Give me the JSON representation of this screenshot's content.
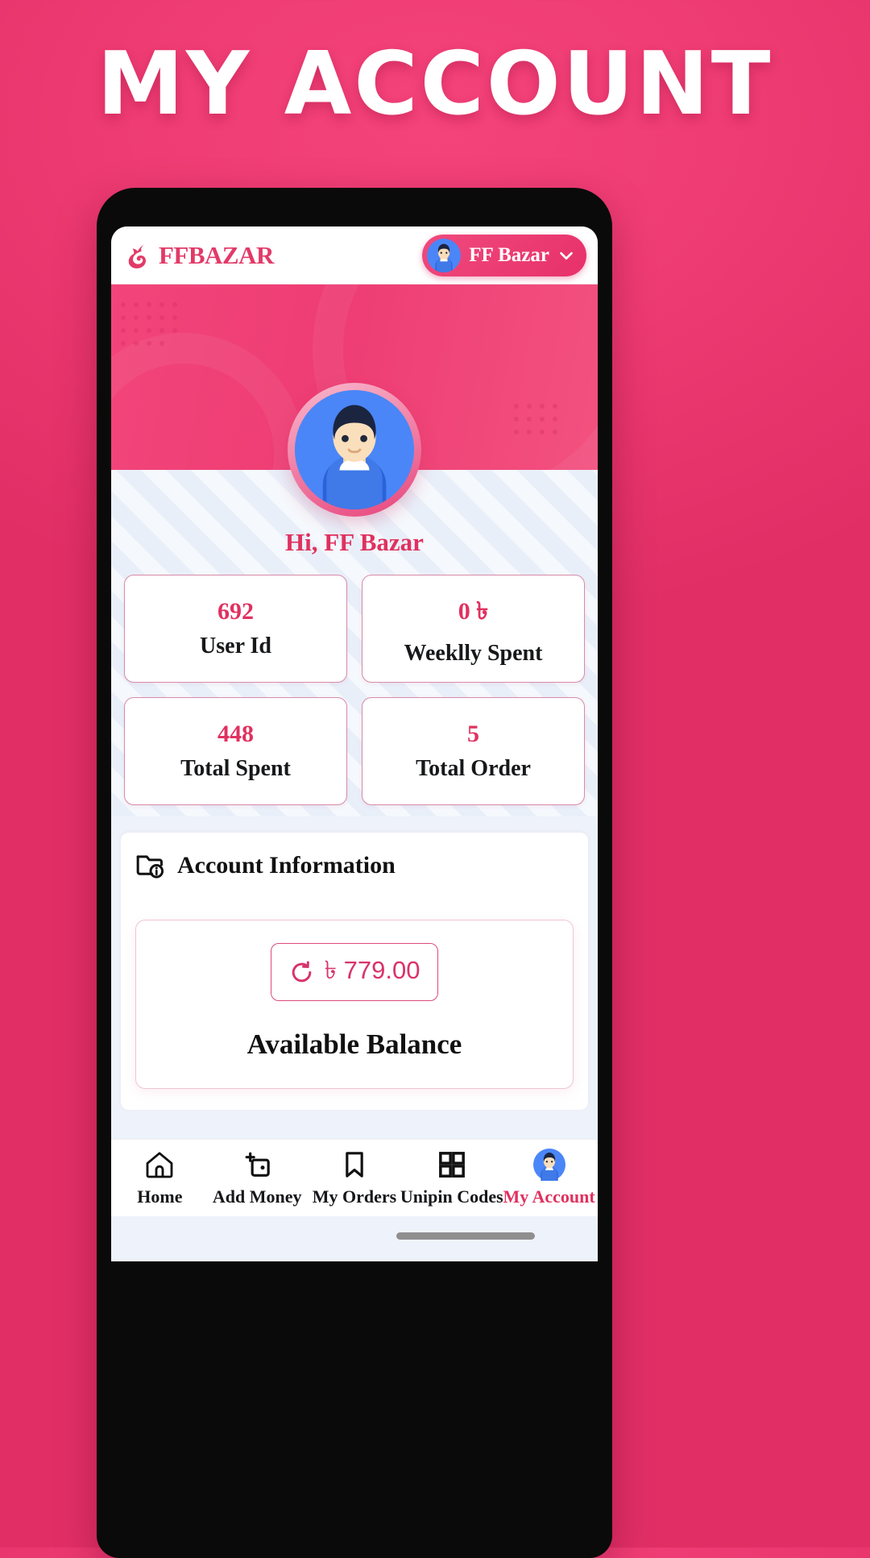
{
  "promo": {
    "title": "MY ACCOUNT"
  },
  "colors": {
    "brand_pink": "#e23a68",
    "accent_pink": "#e0315f",
    "bg_pink": "#ef3c74",
    "card_border": "#d98aa8",
    "avatar_blue": "#4a86f7"
  },
  "app_header": {
    "logo_text": "FFBAZAR",
    "logo_icon": "freefire-logo-icon",
    "profile": {
      "name": "FF Bazar",
      "avatar_icon": "user-avatar-icon",
      "chevron_icon": "chevron-down-icon"
    }
  },
  "profile_section": {
    "avatar_icon": "user-avatar-large-icon",
    "greeting": "Hi, FF Bazar"
  },
  "stats": [
    {
      "value": "692",
      "label": "User Id"
    },
    {
      "value": "0 ৳",
      "label": "Weeklly Spent"
    },
    {
      "value": "448",
      "label": "Total Spent"
    },
    {
      "value": "5",
      "label": "Total Order"
    }
  ],
  "account_information": {
    "icon": "folder-info-icon",
    "title": "Account Information",
    "balance": {
      "refresh_icon": "refresh-icon",
      "amount": "৳ 779.00",
      "label": "Available Balance"
    }
  },
  "bottom_nav": {
    "items": [
      {
        "label": "Home",
        "icon": "home-icon",
        "active": false
      },
      {
        "label": "Add Money",
        "icon": "wallet-plus-icon",
        "active": false
      },
      {
        "label": "My Orders",
        "icon": "bookmark-icon",
        "active": false
      },
      {
        "label": "Unipin Codes",
        "icon": "grid-icon",
        "active": false
      },
      {
        "label": "My Account",
        "icon": "user-avatar-icon",
        "active": true
      }
    ]
  }
}
